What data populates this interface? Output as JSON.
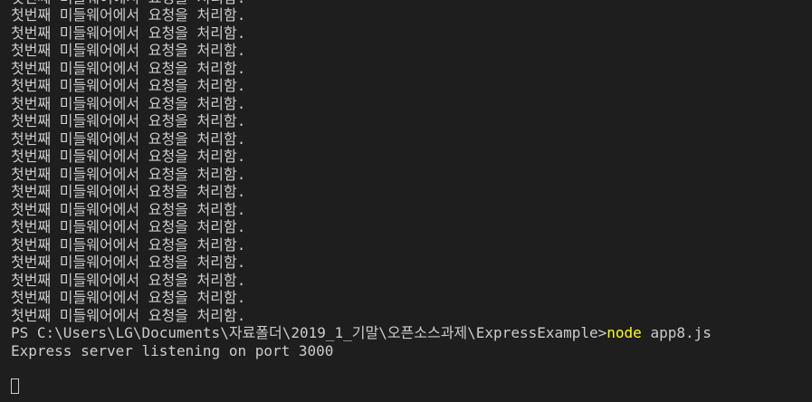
{
  "terminal": {
    "log_lines": [
      "첫번째 미들웨어에서 요청을 처리함.",
      "첫번째 미들웨어에서 요청을 처리함.",
      "첫번째 미들웨어에서 요청을 처리함.",
      "첫번째 미들웨어에서 요청을 처리함.",
      "첫번째 미들웨어에서 요청을 처리함.",
      "첫번째 미들웨어에서 요청을 처리함.",
      "첫번째 미들웨어에서 요청을 처리함.",
      "첫번째 미들웨어에서 요청을 처리함.",
      "첫번째 미들웨어에서 요청을 처리함.",
      "첫번째 미들웨어에서 요청을 처리함.",
      "첫번째 미들웨어에서 요청을 처리함.",
      "첫번째 미들웨어에서 요청을 처리함.",
      "첫번째 미들웨어에서 요청을 처리함.",
      "첫번째 미들웨어에서 요청을 처리함.",
      "첫번째 미들웨어에서 요청을 처리함.",
      "첫번째 미들웨어에서 요청을 처리함.",
      "첫번째 미들웨어에서 요청을 처리함.",
      "첫번째 미들웨어에서 요청을 처리함.",
      "첫번째 미들웨어에서 요청을 처리함."
    ],
    "prompt": {
      "path": "PS C:\\Users\\LG\\Documents\\자료폴더\\2019_1_기말\\오픈소스과제\\ExpressExample>",
      "command": "node",
      "args": " app8.js"
    },
    "output_line": "Express server listening on port 3000",
    "colors": {
      "background": "#1e1e1e",
      "text": "#cccccc",
      "command": "#ffff00"
    }
  }
}
